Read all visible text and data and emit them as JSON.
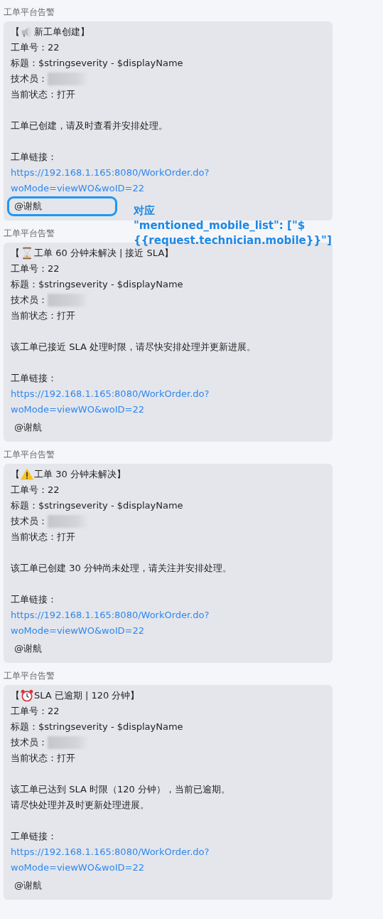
{
  "messages": [
    {
      "sender": "工单平台告警",
      "title": {
        "open": "【",
        "kind": "megaphone",
        "text": "新工单创建】"
      },
      "ticket": "工单号：22",
      "subject": "标题：$stringseverity - $displayName",
      "technician": {
        "label": "技术员：",
        "redacted": true
      },
      "status": "当前状态：打开",
      "body": [
        "工单已创建，请及时查看并安排处理。"
      ],
      "link_label": "工单链接：",
      "link": [
        "https://192.168.1.165:8080/WorkOrder.do?",
        "woMode=viewWO&woID=22"
      ],
      "mention": {
        "text": "@谢航",
        "highlighted": true
      },
      "annotation": [
        "对应",
        "\"mentioned_mobile_list\": [\"$",
        "{{request.technician.mobile}}\"]"
      ]
    },
    {
      "sender": "工单平台告警",
      "title": {
        "open": "【",
        "kind": "hourglass",
        "text": "工单 60 分钟未解决 | 接近 SLA】"
      },
      "ticket": "工单号：22",
      "subject": "标题：$stringseverity - $displayName",
      "technician": {
        "label": "技术员：",
        "redacted": true
      },
      "status": "当前状态：打开",
      "body": [
        "该工单已接近 SLA 处理时限，请尽快安排处理并更新进展。"
      ],
      "link_label": "工单链接：",
      "link": [
        "https://192.168.1.165:8080/WorkOrder.do?",
        "woMode=viewWO&woID=22"
      ],
      "mention": {
        "text": "@谢航",
        "highlighted": false
      }
    },
    {
      "sender": "工单平台告警",
      "title": {
        "open": "【",
        "kind": "warning",
        "text": "工单 30 分钟未解决】"
      },
      "ticket": "工单号：22",
      "subject": "标题：$stringseverity - $displayName",
      "technician": {
        "label": "技术员：",
        "redacted": true
      },
      "status": "当前状态：打开",
      "body": [
        "该工单已创建 30 分钟尚未处理，请关注并安排处理。"
      ],
      "link_label": "工单链接：",
      "link": [
        "https://192.168.1.165:8080/WorkOrder.do?",
        "woMode=viewWO&woID=22"
      ],
      "mention": {
        "text": "@谢航",
        "highlighted": false
      }
    },
    {
      "sender": "工单平台告警",
      "title": {
        "open": "【",
        "kind": "alarm-clock",
        "text": "SLA 已逾期 | 120 分钟】"
      },
      "ticket": "工单号：22",
      "subject": "标题：$stringseverity - $displayName",
      "technician": {
        "label": "技术员：",
        "redacted": true
      },
      "status": "当前状态：打开",
      "body": [
        "该工单已达到 SLA 时限（120 分钟），当前已逾期。",
        "请尽快处理并及时更新处理进展。"
      ],
      "link_label": "工单链接：",
      "link": [
        "https://192.168.1.165:8080/WorkOrder.do?",
        "woMode=viewWO&woID=22"
      ],
      "mention": {
        "text": "@谢航",
        "highlighted": false
      }
    }
  ]
}
